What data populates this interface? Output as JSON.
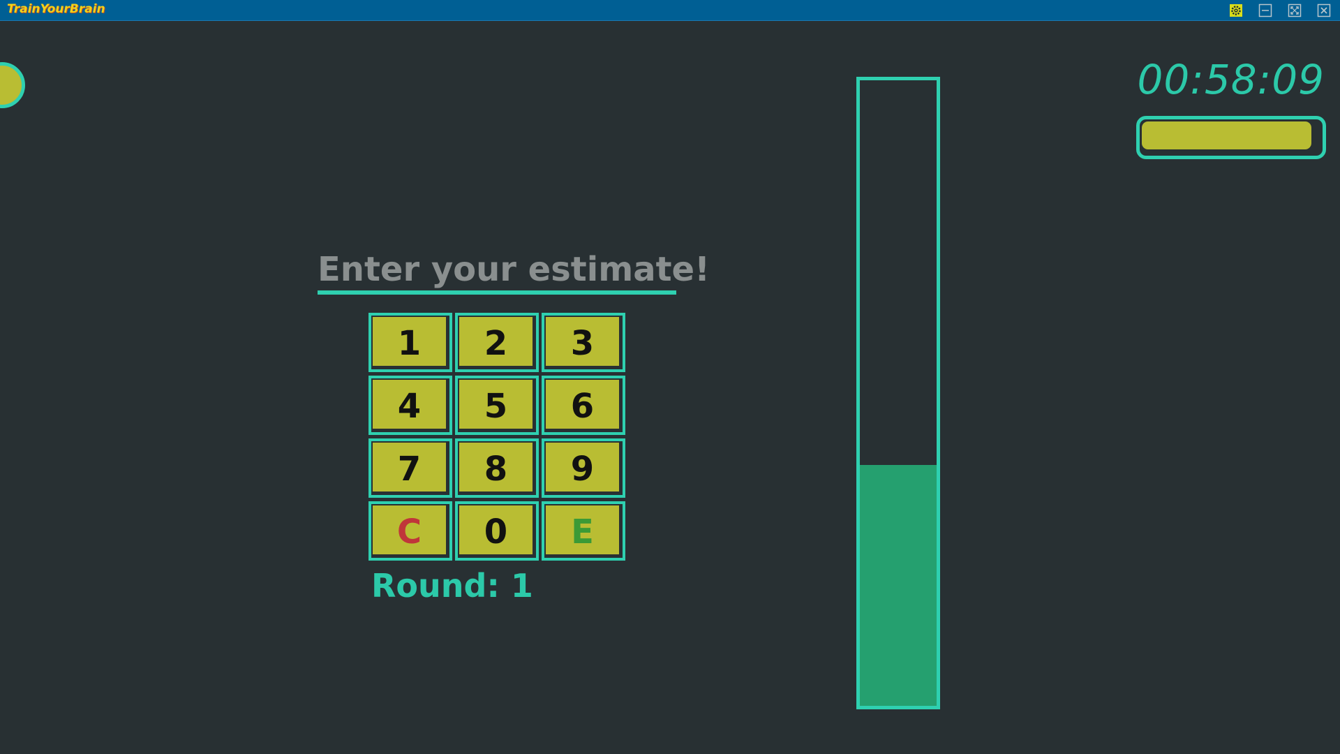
{
  "window": {
    "title": "TrainYourBrain",
    "controls": {
      "settings": "settings-icon",
      "minimize": "minimize-icon",
      "maximize": "maximize-icon",
      "close": "close-icon"
    }
  },
  "timer": {
    "text": "00:58:09",
    "remaining_fraction": 0.95
  },
  "prompt": {
    "text": "Enter your estimate!"
  },
  "keypad": {
    "keys": [
      "1",
      "2",
      "3",
      "4",
      "5",
      "6",
      "7",
      "8",
      "9",
      "C",
      "0",
      "E"
    ],
    "clear_color": "#c0363a",
    "enter_color": "#3b9a36"
  },
  "round": {
    "text": "Round: 1"
  },
  "progress_meter": {
    "fill_fraction": 0.385
  },
  "colors": {
    "background": "#283033",
    "accent": "#2fd0b0",
    "button": "#b9bd33",
    "meter_fill": "#25a06f",
    "titlebar": "#005f94"
  }
}
